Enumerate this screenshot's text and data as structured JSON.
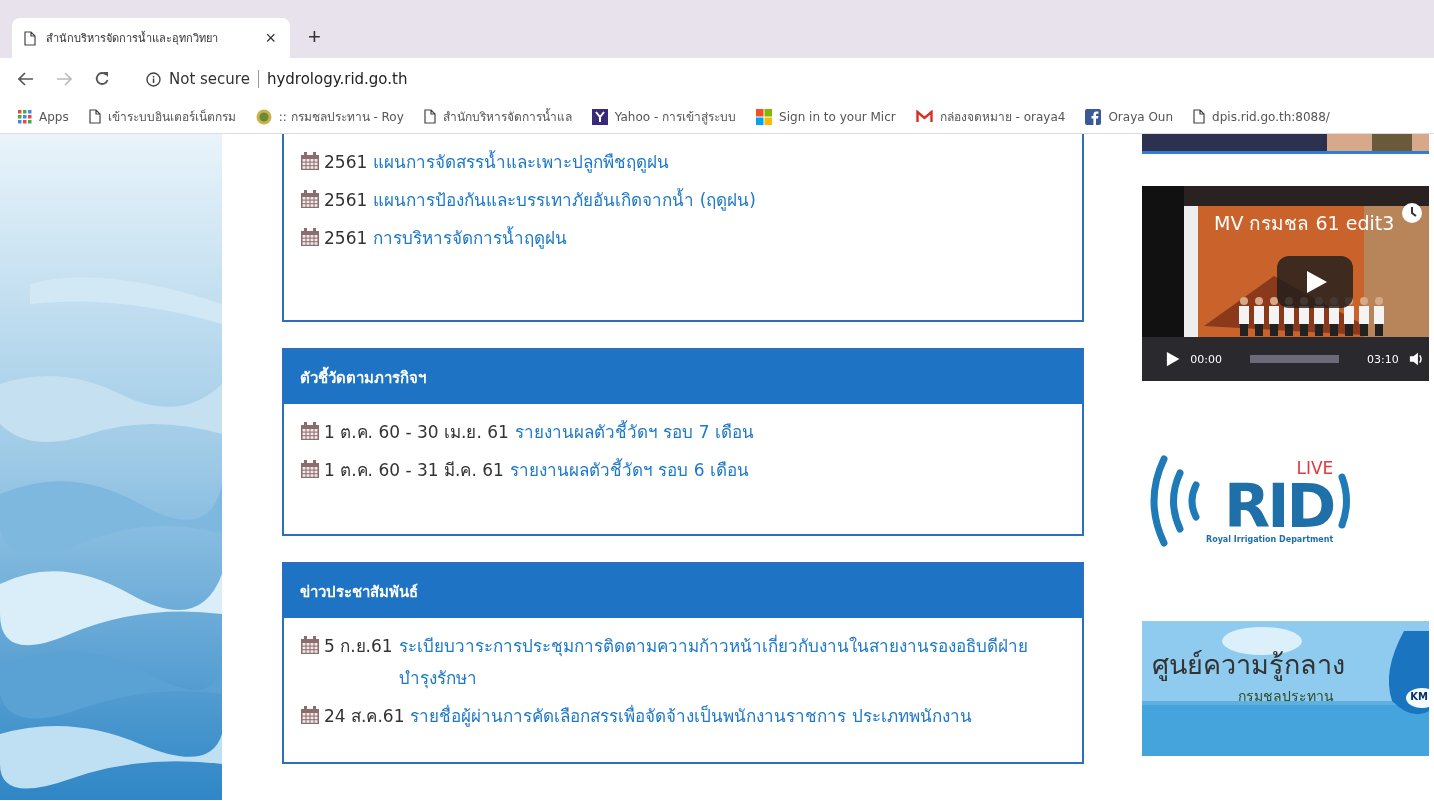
{
  "browser": {
    "tab": {
      "title": "สำนักบริหารจัดการน้ำและอุทกวิทยา",
      "close": "×",
      "selected": true
    },
    "new_tab": "+",
    "address": {
      "security": "Not secure",
      "url": "hydrology.rid.go.th"
    },
    "bookmarks": [
      {
        "kind": "apps",
        "label": "Apps"
      },
      {
        "kind": "page",
        "label": "เข้าระบบอินเตอร์เน็ตกรม"
      },
      {
        "kind": "emblem",
        "label": ":: กรมชลประทาน - Roy"
      },
      {
        "kind": "page",
        "label": "สำนักบริหารจัดการน้ำแล"
      },
      {
        "kind": "yahoo",
        "label": "Yahoo - การเข้าสู่ระบบ"
      },
      {
        "kind": "microsoft",
        "label": "Sign in to your Micr"
      },
      {
        "kind": "gmail",
        "label": "กล่องจดหมาย - oraya4"
      },
      {
        "kind": "facebook",
        "label": "Oraya Oun"
      },
      {
        "kind": "page",
        "label": "dpis.rid.go.th:8088/"
      }
    ]
  },
  "sections": [
    {
      "items": [
        {
          "date": "2561",
          "title": "แผนการจัดสรรน้ำและเพาะปลูกพืชฤดูฝน"
        },
        {
          "date": "2561",
          "title": "แผนการป้องกันและบรรเทาภัยอันเกิดจากน้ำ (ฤดูฝน)"
        },
        {
          "date": "2561",
          "title": "การบริหารจัดการน้ำฤดูฝน"
        }
      ]
    },
    {
      "header": "ตัวชี้วัดตามภารกิจฯ",
      "items": [
        {
          "date": "1 ต.ค. 60 - 30 เม.ย. 61",
          "title": "รายงานผลตัวชี้วัดฯ รอบ 7 เดือน"
        },
        {
          "date": "1 ต.ค. 60 - 31 มี.ค. 61",
          "title": "รายงานผลตัวชี้วัดฯ รอบ 6 เดือน"
        }
      ]
    },
    {
      "header": "ข่าวประชาสัมพันธ์",
      "items": [
        {
          "date": "5 ก.ย.61",
          "title": "ระเบียบวาระการประชุมการติดตามความก้าวหน้าเกี่ยวกับงานในสายงานรองอธิบดีฝ่ายบำรุงรักษา"
        },
        {
          "date": "24 ส.ค.61",
          "title": "รายชื่อผู้ผ่านการคัดเลือกสรรเพื่อจัดจ้างเป็นพนักงานราชการ ประเภทพนักงาน"
        }
      ]
    }
  ],
  "video": {
    "title": "MV กรมชล 61 edit3",
    "current": "00:00",
    "duration": "03:10"
  },
  "live_logo": {
    "live": "LIVE",
    "mark": "RID",
    "caption": "Royal Irrigation Department"
  },
  "km_banner": {
    "title": "ศูนย์ความรู้กลาง",
    "subtitle": "กรมชลประทาน",
    "badge": "KM"
  }
}
